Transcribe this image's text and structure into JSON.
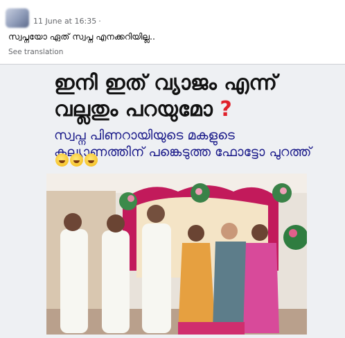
{
  "post": {
    "timestamp": "11 June at 16:35",
    "separator": "·",
    "text": "സ്വപ്നയോ ഏത് സ്വപ്ന എനക്കറിയില്ല..",
    "see_translation": "See translation"
  },
  "image": {
    "headline_line1": "ഇനി ഇത് വ്യാജം എന്ന്",
    "headline_line2": "വല്ലതും പറയുമോ",
    "question_mark": "?",
    "subtitle_line1": "സ്വപ്ന പിണറായിയുടെ മകളുടെ",
    "subtitle_line2": "കല്യാണത്തിന് പങ്കെടുത്ത ഫോട്ടോ പുറത്ത്",
    "emojis": [
      "grinning-face-icon",
      "grinning-face-icon",
      "grinning-face-icon"
    ]
  },
  "colors": {
    "headline": "#111111",
    "question_mark": "#e0202a",
    "subtitle": "#1b1b8a",
    "meta_gray": "#65676b",
    "backdrop_pink": "#c21a5b"
  }
}
